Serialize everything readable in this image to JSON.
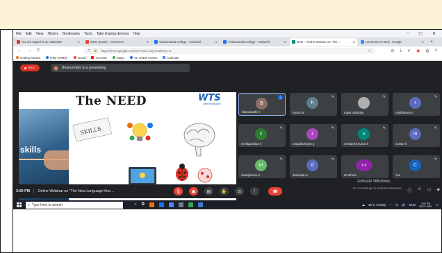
{
  "browser": {
    "menu": [
      "File",
      "Edit",
      "View",
      "History",
      "Bookmarks",
      "Tools",
      "Take sharing devices",
      "Help"
    ],
    "window_controls": [
      "–",
      "▢",
      "✕"
    ],
    "tabs": [
      {
        "label": "You are signed in as, subscribe",
        "color": "#d93025"
      },
      {
        "label": "Inbox (2,569) - commerce…",
        "color": "#ea4335"
      },
      {
        "label": "Vivekananda College · Colourful",
        "color": "#1a73e8"
      },
      {
        "label": "Vivekananda College · Colourful",
        "color": "#1a73e8"
      },
      {
        "label": "Meet – Online Webinar on \"The…",
        "color": "#00897b",
        "active": true
      },
      {
        "label": "connective in tamil · Google",
        "color": "#4285f4"
      }
    ],
    "new_tab": "+",
    "nav": [
      "←",
      "→",
      "C"
    ],
    "url": "https://meet.google.com/xnz-xbca-xdy?authuser=0",
    "bookmarks": [
      {
        "label": "Getting Started",
        "color": "#e8710a"
      },
      {
        "label": "(Flat–ERMS)-",
        "color": "#1a73e8"
      },
      {
        "label": "Gmail",
        "color": "#ea4335"
      },
      {
        "label": "YouTube",
        "color": "#ff0000"
      },
      {
        "label": "Maps",
        "color": "#34a853"
      },
      {
        "label": "VC USER LOGIN",
        "color": "#1a73e8"
      },
      {
        "label": "Calendar",
        "color": "#4285f4"
      }
    ]
  },
  "meet": {
    "rec_label": "REC",
    "presenter_initial": "B",
    "presenting_text": "Bhanumathi S is presenting",
    "slide": {
      "title": "The NEED",
      "logo": "WTS",
      "logo_sub": "WebTechSource",
      "skills_word": "skills",
      "icon_labels": [
        "SKILLS",
        "Bug",
        "Reality"
      ]
    },
    "participants": [
      {
        "initial": "B",
        "name": "Bhanumathi S",
        "color": "#8d6e63",
        "active": true
      },
      {
        "initial": "h",
        "name": "harish ss",
        "color": "#607d8b"
      },
      {
        "initial": "",
        "name": "rupini prithiviraj",
        "color": "#9e9e9e"
      },
      {
        "initial": "r",
        "name": "ranjithkumar c",
        "color": "#5c6bc0"
      },
      {
        "initial": "c",
        "name": "chellapandian k",
        "color": "#2e7d32"
      },
      {
        "initial": "r",
        "name": "rangabashyam g",
        "color": "#ab47bc"
      },
      {
        "initial": "v",
        "name": "venkatesh kumar k",
        "color": "#00897b"
      },
      {
        "initial": "m",
        "name": "mohan k",
        "color": "#5c6bc0"
      },
      {
        "initial": "m",
        "name": "manojkumar d",
        "color": "#66bb6a"
      },
      {
        "initial": "d",
        "name": "durairajan p",
        "color": "#5c6bc0"
      },
      {
        "initial": "b  d",
        "name": "63 others",
        "color": "#8e24aa"
      },
      {
        "initial": "C",
        "name": "You",
        "color": "#1565c0"
      }
    ],
    "time": "3:00 PM",
    "meeting_title": "Online Webinar on \"The New Language Kno…",
    "activate_title": "Activate Windows",
    "activate_sub": "Go to Settings to activate Windows."
  },
  "taskbar": {
    "search_placeholder": "Type here to search",
    "weather": "35°C  Cloudy",
    "time": "3:00 PM",
    "date": "08-07-2021"
  }
}
